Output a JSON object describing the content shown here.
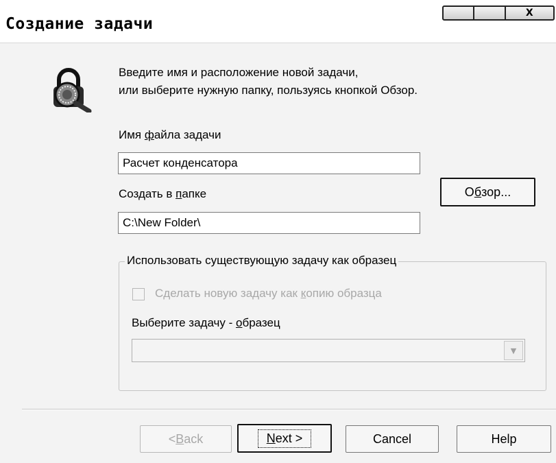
{
  "window": {
    "title": "Создание задачи",
    "close_glyph": "X"
  },
  "instructions": {
    "line1": "Введите имя и расположение новой задачи,",
    "line2": "или выберите нужную папку, пользуясь кнопкой Обзор."
  },
  "filename": {
    "label_pre": "Имя ",
    "label_accel": "ф",
    "label_post": "айла задачи",
    "value": "Расчет конденсатора"
  },
  "folder": {
    "label_pre": "Создать в ",
    "label_accel": "п",
    "label_post": "апке",
    "value": "C:\\New Folder\\"
  },
  "browse_button": {
    "pre": "О",
    "accel": "б",
    "post": "зор..."
  },
  "template_group": {
    "legend": "Использовать существующую задачу как образец",
    "checkbox_pre": "Сделать новую задачу как ",
    "checkbox_accel": "к",
    "checkbox_post": "опию образца",
    "checked": false,
    "select_label_pre": "Выберите задачу - ",
    "select_label_accel": "о",
    "select_label_post": "бразец",
    "select_value": ""
  },
  "footer": {
    "back_pre": "< ",
    "back_accel": "B",
    "back_post": "ack",
    "next_accel": "N",
    "next_post": "ext >",
    "cancel": "Cancel",
    "help": "Help"
  },
  "icons": {
    "wizard": "magnifier-lock-icon",
    "dropdown": "chevron-down-icon"
  }
}
